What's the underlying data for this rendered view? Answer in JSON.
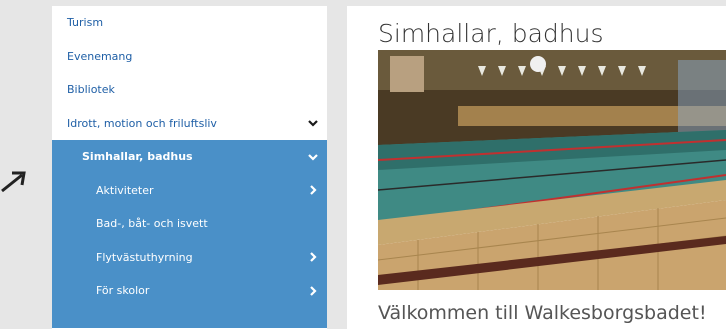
{
  "sidebar": {
    "items": [
      {
        "label": "Turism"
      },
      {
        "label": "Evenemang"
      },
      {
        "label": "Bibliotek"
      },
      {
        "label": "Idrott, motion och friluftsliv"
      }
    ],
    "active_section": {
      "label": "Simhallar, badhus",
      "children": [
        {
          "label": "Aktiviteter"
        },
        {
          "label": "Bad-, båt- och isvett"
        },
        {
          "label": "Flytvästuthyrning"
        },
        {
          "label": "För skolor"
        }
      ]
    }
  },
  "main": {
    "title": "Simhallar, badhus",
    "welcome": "Välkommen till Walkesborgsbadet!"
  },
  "colors": {
    "link": "#1f5fa6",
    "submenu_bg": "#4a90c8"
  }
}
